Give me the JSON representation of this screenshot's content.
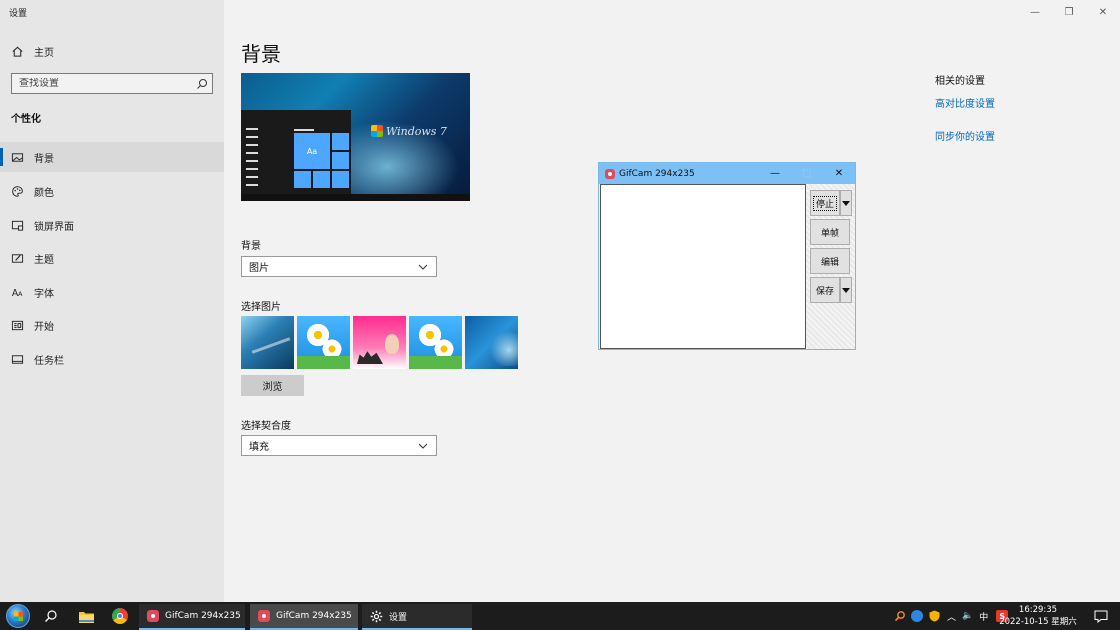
{
  "window": {
    "title": "设置",
    "minimize": "—",
    "restore": "❐",
    "close": "✕"
  },
  "sidebar": {
    "home": "主页",
    "search_placeholder": "查找设置",
    "section": "个性化",
    "items": [
      {
        "label": "背景",
        "icon": "image-icon"
      },
      {
        "label": "颜色",
        "icon": "palette-icon"
      },
      {
        "label": "锁屏界面",
        "icon": "lock-screen-icon"
      },
      {
        "label": "主题",
        "icon": "theme-icon"
      },
      {
        "label": "字体",
        "icon": "font-icon"
      },
      {
        "label": "开始",
        "icon": "start-icon"
      },
      {
        "label": "任务栏",
        "icon": "taskbar-icon"
      }
    ]
  },
  "main": {
    "title": "背景",
    "preview": {
      "tile_text": "Aa",
      "logo_text": "Windows 7"
    },
    "background_label": "背景",
    "background_value": "图片",
    "choose_picture_label": "选择图片",
    "browse_label": "浏览",
    "fit_label": "选择契合度",
    "fit_value": "填充",
    "related": {
      "heading": "相关的设置",
      "links": [
        "高对比度设置",
        "同步你的设置"
      ]
    }
  },
  "gifcam": {
    "title": "GifCam 294x235",
    "minimize": "—",
    "maximize": "□",
    "close": "✕",
    "buttons": [
      "停止",
      "单帧",
      "编辑",
      "保存"
    ]
  },
  "taskbar": {
    "tasks": [
      "GifCam 294x235",
      "GifCam 294x235",
      "设置"
    ],
    "ime": "中",
    "time": "16:29:35",
    "date": "2022-10-15 星期六"
  }
}
